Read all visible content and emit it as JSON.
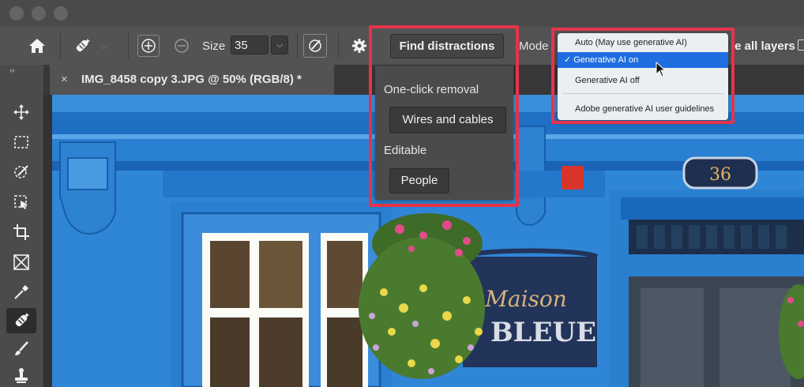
{
  "options_bar": {
    "size_label": "Size",
    "size_value": "35",
    "find_distractions": "Find distractions",
    "mode_label": "Mode",
    "sample_all_layers": "le all layers"
  },
  "document": {
    "close": "×",
    "tab_title": "IMG_8458 copy 3.JPG @ 50% (RGB/8) *"
  },
  "find_panel": {
    "one_click_removal": "One-click removal",
    "wires_and_cables": "Wires and cables",
    "editable": "Editable",
    "people": "People"
  },
  "mode_menu": {
    "auto": "Auto (May use generative AI)",
    "checkmark": "✓",
    "generative_ai_on": "Generative AI on",
    "generative_ai_off": "Generative AI off",
    "guidelines": "Adobe generative AI user guidelines"
  },
  "photo": {
    "sign_line1": "Maison",
    "sign_line2": "BLEUE",
    "door_number": "36"
  },
  "toolbar_expand": "››",
  "colors": {
    "highlight": "#e6334a",
    "menu_selected": "#1f6de0",
    "facade_blue": "#2f86d6"
  }
}
